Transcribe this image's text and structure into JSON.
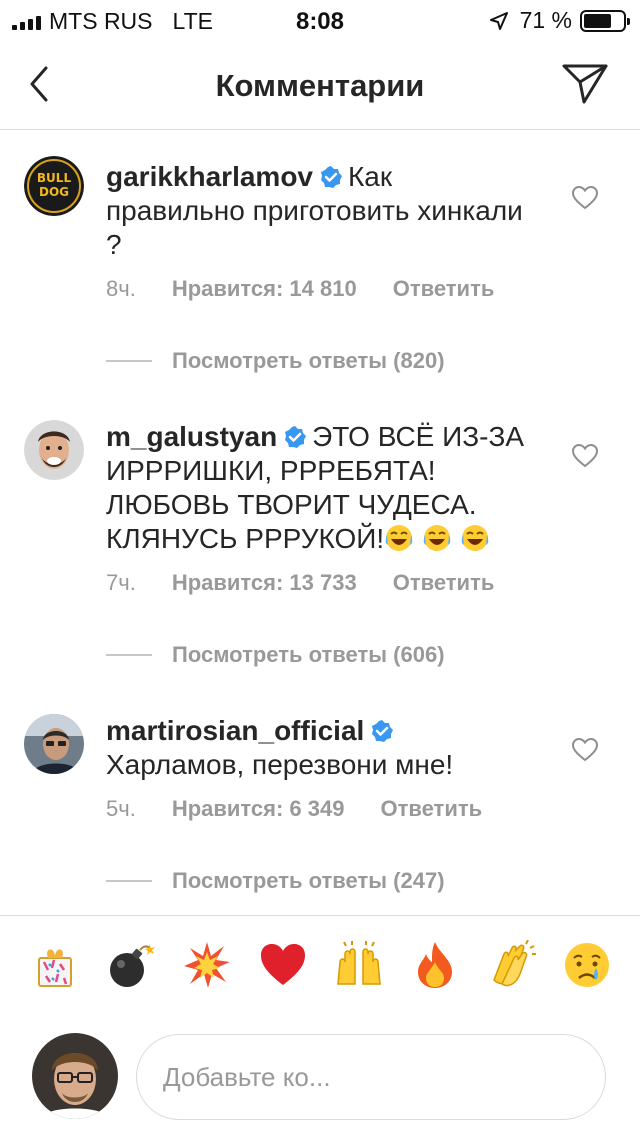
{
  "status_bar": {
    "carrier": "MTS RUS",
    "network": "LTE",
    "time": "8:08",
    "battery_text": "71 %",
    "battery_level": 0.71
  },
  "header": {
    "title": "Комментарии",
    "back_icon": "chevron-left-icon",
    "send_icon": "paper-plane-icon"
  },
  "comments": [
    {
      "username": "garikkharlamov",
      "verified": true,
      "text": "Как правильно приготовить хинкали ?",
      "time": "8ч.",
      "likes": "Нравится: 14 810",
      "reply": "Ответить",
      "view_replies": "Посмотреть ответы (820)"
    },
    {
      "username": "m_galustyan",
      "verified": true,
      "text": "ЭТО ВСЁ ИЗ-ЗА ИРРРИШКИ, РРРЕБЯТА! ЛЮБОВЬ ТВОРИТ ЧУДЕСА. КЛЯНУСЬ РРРУКОЙ!",
      "emoji": "face-with-tears-of-joy x3",
      "time": "7ч.",
      "likes": "Нравится: 13 733",
      "reply": "Ответить",
      "view_replies": "Посмотреть ответы (606)"
    },
    {
      "username": "martirosian_official",
      "verified": true,
      "text": "Харламов, перезвони мне!",
      "time": "5ч.",
      "likes": "Нравится: 6 349",
      "reply": "Ответить",
      "view_replies": "Посмотреть ответы (247)"
    }
  ],
  "emoji_bar": [
    "party-popper-icon",
    "bomb-icon",
    "collision-icon",
    "red-heart-icon",
    "raising-hands-icon",
    "fire-icon",
    "clapping-hands-icon",
    "crying-face-icon"
  ],
  "composer": {
    "placeholder": "Добавьте ко..."
  },
  "colors": {
    "text": "#262626",
    "secondary": "#999999",
    "verified": "#3897f0",
    "divider": "#dbdbdb"
  }
}
